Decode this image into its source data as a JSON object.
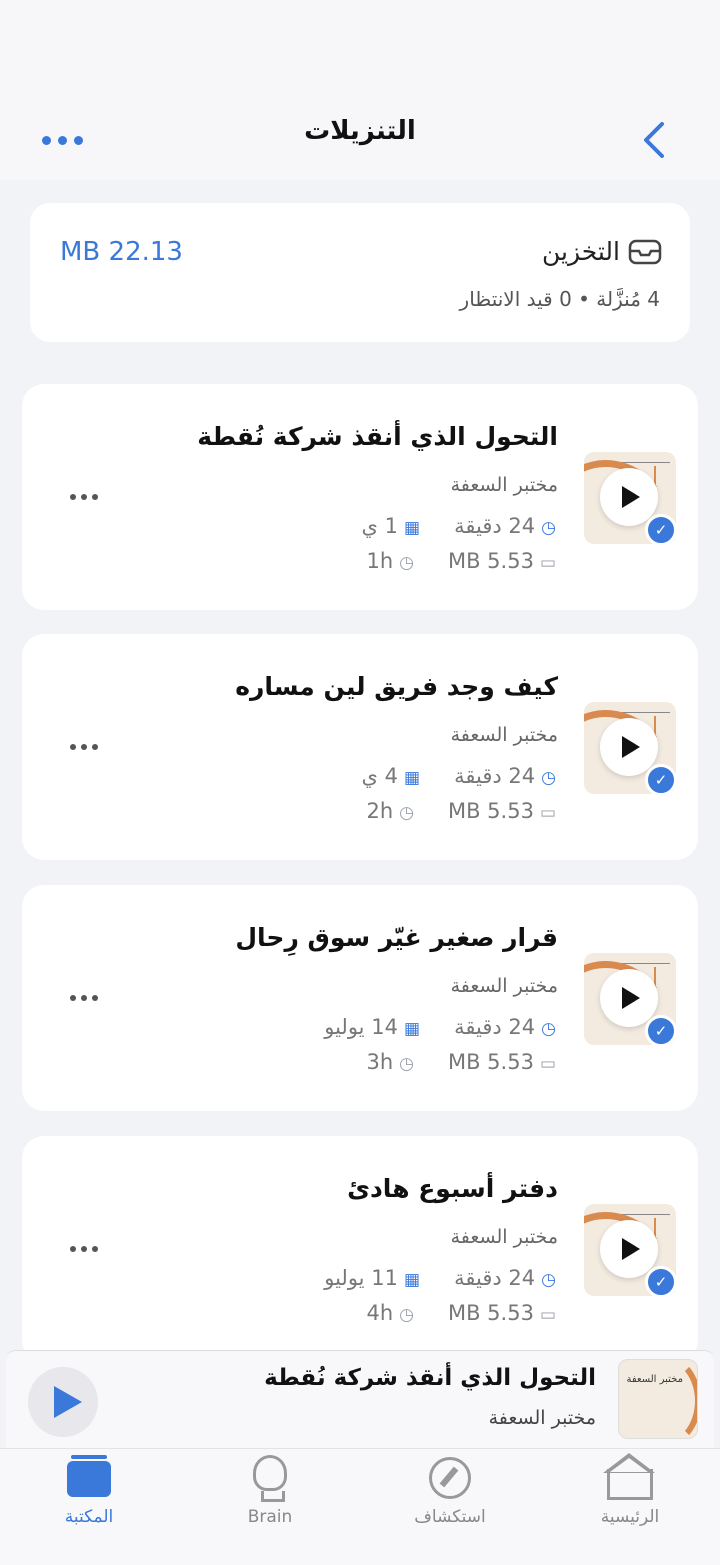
{
  "header": {
    "title": "التنزيلات"
  },
  "storage": {
    "title": "التخزين",
    "size": "MB 22.13",
    "subtitle": "4 مُنزَّلة • 0 قيد الانتظار"
  },
  "downloads": [
    {
      "title": "التحول الذي أنقذ شركة نُقطة",
      "author": "مختبر السعفة",
      "duration": "24 دقيقة",
      "date": "1 ي",
      "size": "MB 5.53",
      "time": "1h"
    },
    {
      "title": "كيف وجد فريق لين مساره",
      "author": "مختبر السعفة",
      "duration": "24 دقيقة",
      "date": "4 ي",
      "size": "MB 5.53",
      "time": "2h"
    },
    {
      "title": "قرار صغير غيّر سوق رِحال",
      "author": "مختبر السعفة",
      "duration": "24 دقيقة",
      "date": "14 يوليو",
      "size": "MB 5.53",
      "time": "3h"
    },
    {
      "title": "دفتر أسبوع هادئ",
      "author": "مختبر السعفة",
      "duration": "24 دقيقة",
      "date": "11 يوليو",
      "size": "MB 5.53",
      "time": "4h"
    }
  ],
  "player": {
    "title": "التحول الذي أنقذ شركة نُقطة",
    "author": "مختبر السعفة",
    "thumb_label": "مختبر السعفة"
  },
  "tabs": {
    "library": "المكتبة",
    "brain": "Brain",
    "explore": "استكشاف",
    "home": "الرئيسية"
  },
  "colors": {
    "accent": "#3a78d9",
    "thumb_orange": "#d98a4e"
  }
}
